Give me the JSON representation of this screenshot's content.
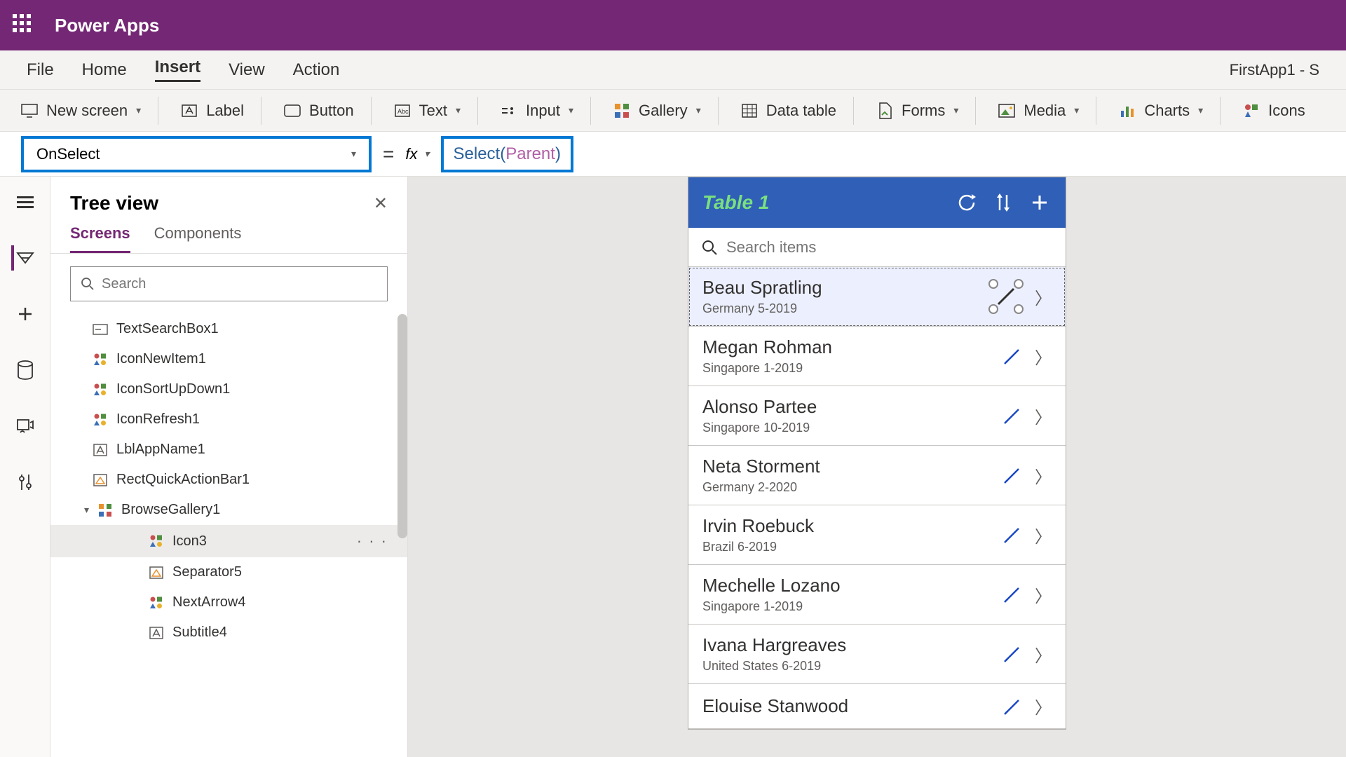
{
  "titlebar": {
    "app_name": "Power Apps"
  },
  "menubar": {
    "file": "File",
    "home": "Home",
    "insert": "Insert",
    "view": "View",
    "action": "Action",
    "doc_name": "FirstApp1 - S"
  },
  "ribbon": {
    "new_screen": "New screen",
    "label": "Label",
    "button": "Button",
    "text": "Text",
    "input": "Input",
    "gallery": "Gallery",
    "data_table": "Data table",
    "forms": "Forms",
    "media": "Media",
    "charts": "Charts",
    "icons": "Icons"
  },
  "formula": {
    "property": "OnSelect",
    "equals": "=",
    "fx": "fx",
    "func": "Select(",
    "arg": "Parent",
    "close": ")"
  },
  "tree": {
    "title": "Tree view",
    "tab_screens": "Screens",
    "tab_components": "Components",
    "search_placeholder": "Search",
    "nodes": [
      {
        "label": "TextSearchBox1",
        "icon": "textbox"
      },
      {
        "label": "IconNewItem1",
        "icon": "icons"
      },
      {
        "label": "IconSortUpDown1",
        "icon": "icons"
      },
      {
        "label": "IconRefresh1",
        "icon": "icons"
      },
      {
        "label": "LblAppName1",
        "icon": "label"
      },
      {
        "label": "RectQuickActionBar1",
        "icon": "shape"
      },
      {
        "label": "BrowseGallery1",
        "icon": "gallery",
        "caret": true
      },
      {
        "label": "Icon3",
        "icon": "icons",
        "indent": 2,
        "selected": true
      },
      {
        "label": "Separator5",
        "icon": "shape",
        "indent": 2
      },
      {
        "label": "NextArrow4",
        "icon": "icons",
        "indent": 2
      },
      {
        "label": "Subtitle4",
        "icon": "label",
        "indent": 2
      }
    ]
  },
  "phone": {
    "title": "Table 1",
    "search_placeholder": "Search items",
    "items": [
      {
        "name": "Beau Spratling",
        "sub": "Germany 5-2019",
        "selected": true
      },
      {
        "name": "Megan Rohman",
        "sub": "Singapore 1-2019"
      },
      {
        "name": "Alonso Partee",
        "sub": "Singapore 10-2019"
      },
      {
        "name": "Neta Storment",
        "sub": "Germany 2-2020"
      },
      {
        "name": "Irvin Roebuck",
        "sub": "Brazil 6-2019"
      },
      {
        "name": "Mechelle Lozano",
        "sub": "Singapore 1-2019"
      },
      {
        "name": "Ivana Hargreaves",
        "sub": "United States 6-2019"
      },
      {
        "name": "Elouise Stanwood",
        "sub": ""
      }
    ]
  }
}
